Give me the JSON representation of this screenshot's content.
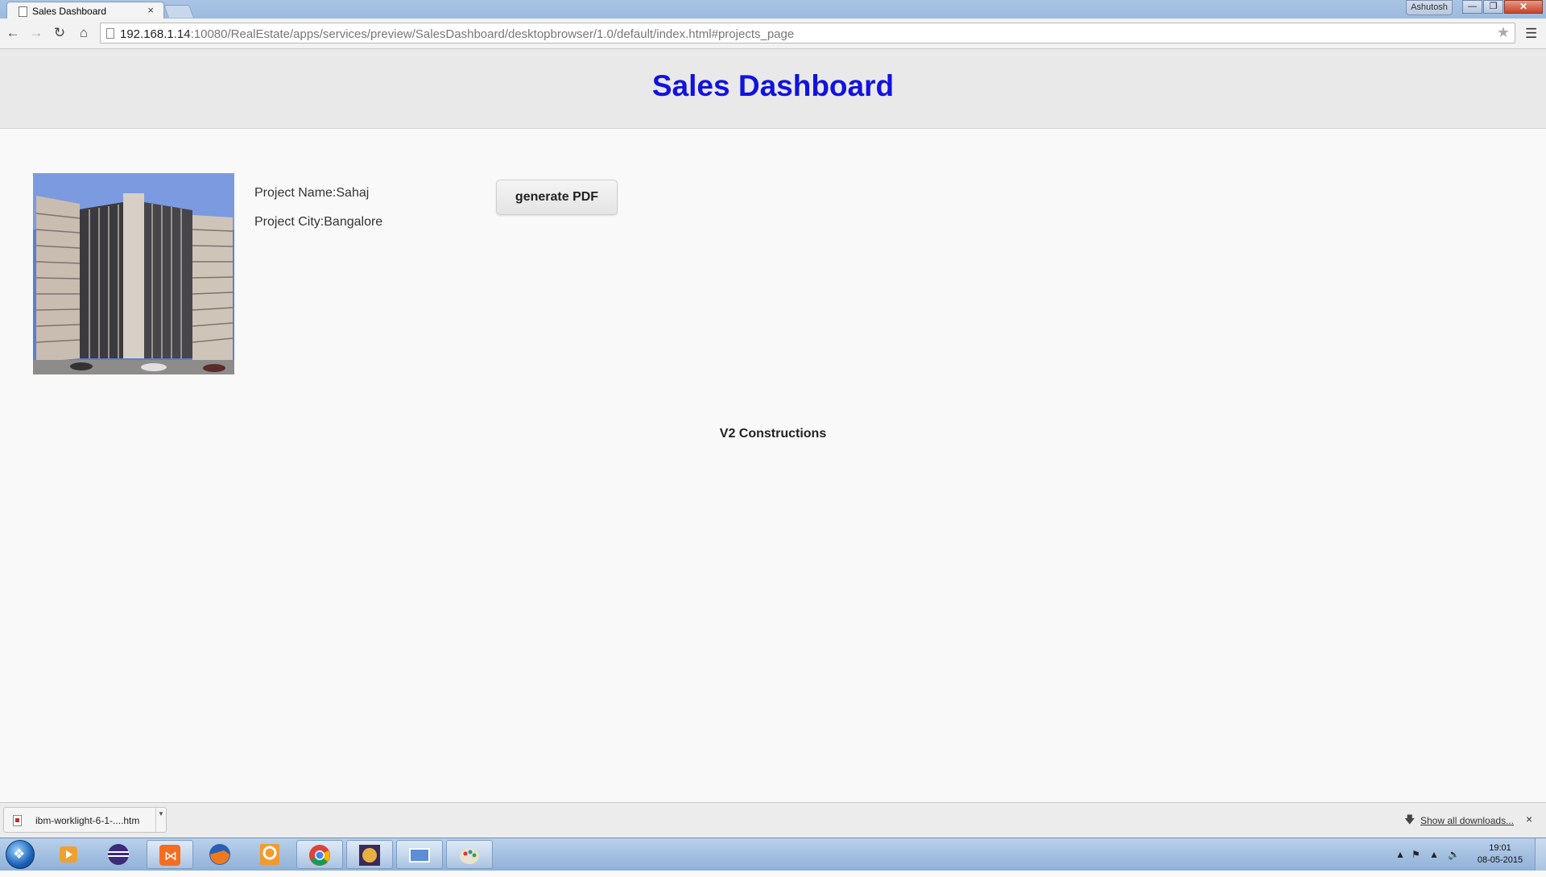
{
  "browser": {
    "tab_title": "Sales Dashboard",
    "tab_close": "×",
    "user_name": "Ashutosh",
    "url_host": "192.168.1.14",
    "url_rest": ":10080/RealEstate/apps/services/preview/SalesDashboard/desktopbrowser/1.0/default/index.html#projects_page",
    "minimize": "—",
    "maximize": "❐",
    "close": "✕"
  },
  "page": {
    "title": "Sales Dashboard",
    "project_name": "Project Name:Sahaj",
    "project_city": "Project City:Bangalore",
    "pdf_button": "generate PDF",
    "footer": "V2 Constructions"
  },
  "downloads": {
    "file_name": "ibm-worklight-6-1-....htm",
    "show_all": "Show all downloads...",
    "close": "×"
  },
  "taskbar": {
    "time": "19:01",
    "date": "08-05-2015"
  },
  "icons": {
    "back": "back-arrow-icon",
    "forward": "forward-arrow-icon",
    "reload": "reload-icon",
    "home": "home-icon",
    "star": "bookmark-star-icon",
    "menu": "hamburger-menu-icon"
  }
}
